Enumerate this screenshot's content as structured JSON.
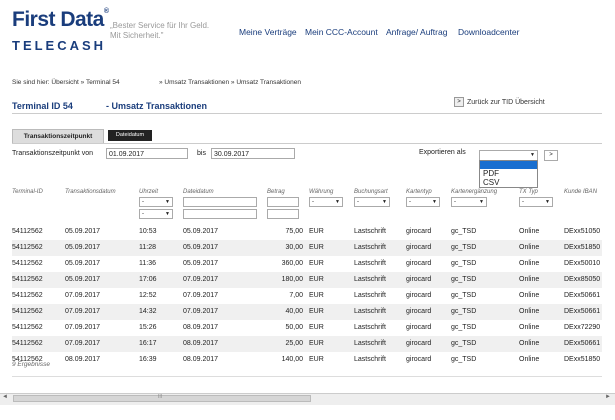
{
  "header": {
    "logo_main": "First Data",
    "logo_mark": "®",
    "logo_sub": "TELECASH",
    "slogan": "„Bester Service für Ihr Geld. Mit Sicherheit.\"",
    "nav": [
      "Meine Verträge",
      "Mein CCC-Account",
      "Anfrage/ Auftrag",
      "Downloadcenter"
    ]
  },
  "breadcrumb": {
    "prefix": "Sie sind hier:",
    "p1": "Übersicht »",
    "p2": "Terminal 54",
    "p3": "» Umsatz Transaktionen » Umsatz Transaktionen"
  },
  "page": {
    "title_id": "Terminal ID 54",
    "title_name": "- Umsatz Transaktionen",
    "back_label": "Zurück zur TID Übersicht",
    "back_icon": ">"
  },
  "tabs": {
    "active": "Transaktionszeitpunkt",
    "inactive": "Dateidatum"
  },
  "filter": {
    "from_label": "Transaktionszeitpunkt von",
    "from_value": "01.09.2017",
    "to_label": "bis",
    "to_value": "30.09.2017",
    "export_label": "Exportieren als",
    "go_icon": ">"
  },
  "export_dropdown": {
    "options": [
      "PDF",
      "CSV"
    ]
  },
  "table": {
    "columns": [
      "Terminal-ID",
      "Transaktionsdatum",
      "Uhrzeit",
      "Dateidatum",
      "Betrag",
      "Währung",
      "Buchungsart",
      "Kartentyp",
      "Kartenergänzung",
      "TX Typ",
      "Kunde IBAN"
    ],
    "filter_dash": "-",
    "rows": [
      [
        "54112562",
        "05.09.2017",
        "10:53",
        "05.09.2017",
        "75,00",
        "EUR",
        "Lastschrift",
        "girocard",
        "gc_TSD",
        "Online",
        "DExx51050"
      ],
      [
        "54112562",
        "05.09.2017",
        "11:28",
        "05.09.2017",
        "30,00",
        "EUR",
        "Lastschrift",
        "girocard",
        "gc_TSD",
        "Online",
        "DExx51850"
      ],
      [
        "54112562",
        "05.09.2017",
        "11:36",
        "05.09.2017",
        "360,00",
        "EUR",
        "Lastschrift",
        "girocard",
        "gc_TSD",
        "Online",
        "DExx50010"
      ],
      [
        "54112562",
        "05.09.2017",
        "17:06",
        "07.09.2017",
        "180,00",
        "EUR",
        "Lastschrift",
        "girocard",
        "gc_TSD",
        "Online",
        "DExx85050"
      ],
      [
        "54112562",
        "07.09.2017",
        "12:52",
        "07.09.2017",
        "7,00",
        "EUR",
        "Lastschrift",
        "girocard",
        "gc_TSD",
        "Online",
        "DExx50661"
      ],
      [
        "54112562",
        "07.09.2017",
        "14:32",
        "07.09.2017",
        "40,00",
        "EUR",
        "Lastschrift",
        "girocard",
        "gc_TSD",
        "Online",
        "DExx50661"
      ],
      [
        "54112562",
        "07.09.2017",
        "15:26",
        "08.09.2017",
        "50,00",
        "EUR",
        "Lastschrift",
        "girocard",
        "gc_TSD",
        "Online",
        "DExx72290"
      ],
      [
        "54112562",
        "07.09.2017",
        "16:17",
        "08.09.2017",
        "25,00",
        "EUR",
        "Lastschrift",
        "girocard",
        "gc_TSD",
        "Online",
        "DExx50661"
      ],
      [
        "54112562",
        "08.09.2017",
        "16:39",
        "08.09.2017",
        "140,00",
        "EUR",
        "Lastschrift",
        "girocard",
        "gc_TSD",
        "Online",
        "DExx51850"
      ]
    ],
    "result_count": "9 Ergebnisse"
  },
  "scrollbar": {
    "left_arrow": "◄",
    "right_arrow": "►",
    "grip": "III"
  }
}
